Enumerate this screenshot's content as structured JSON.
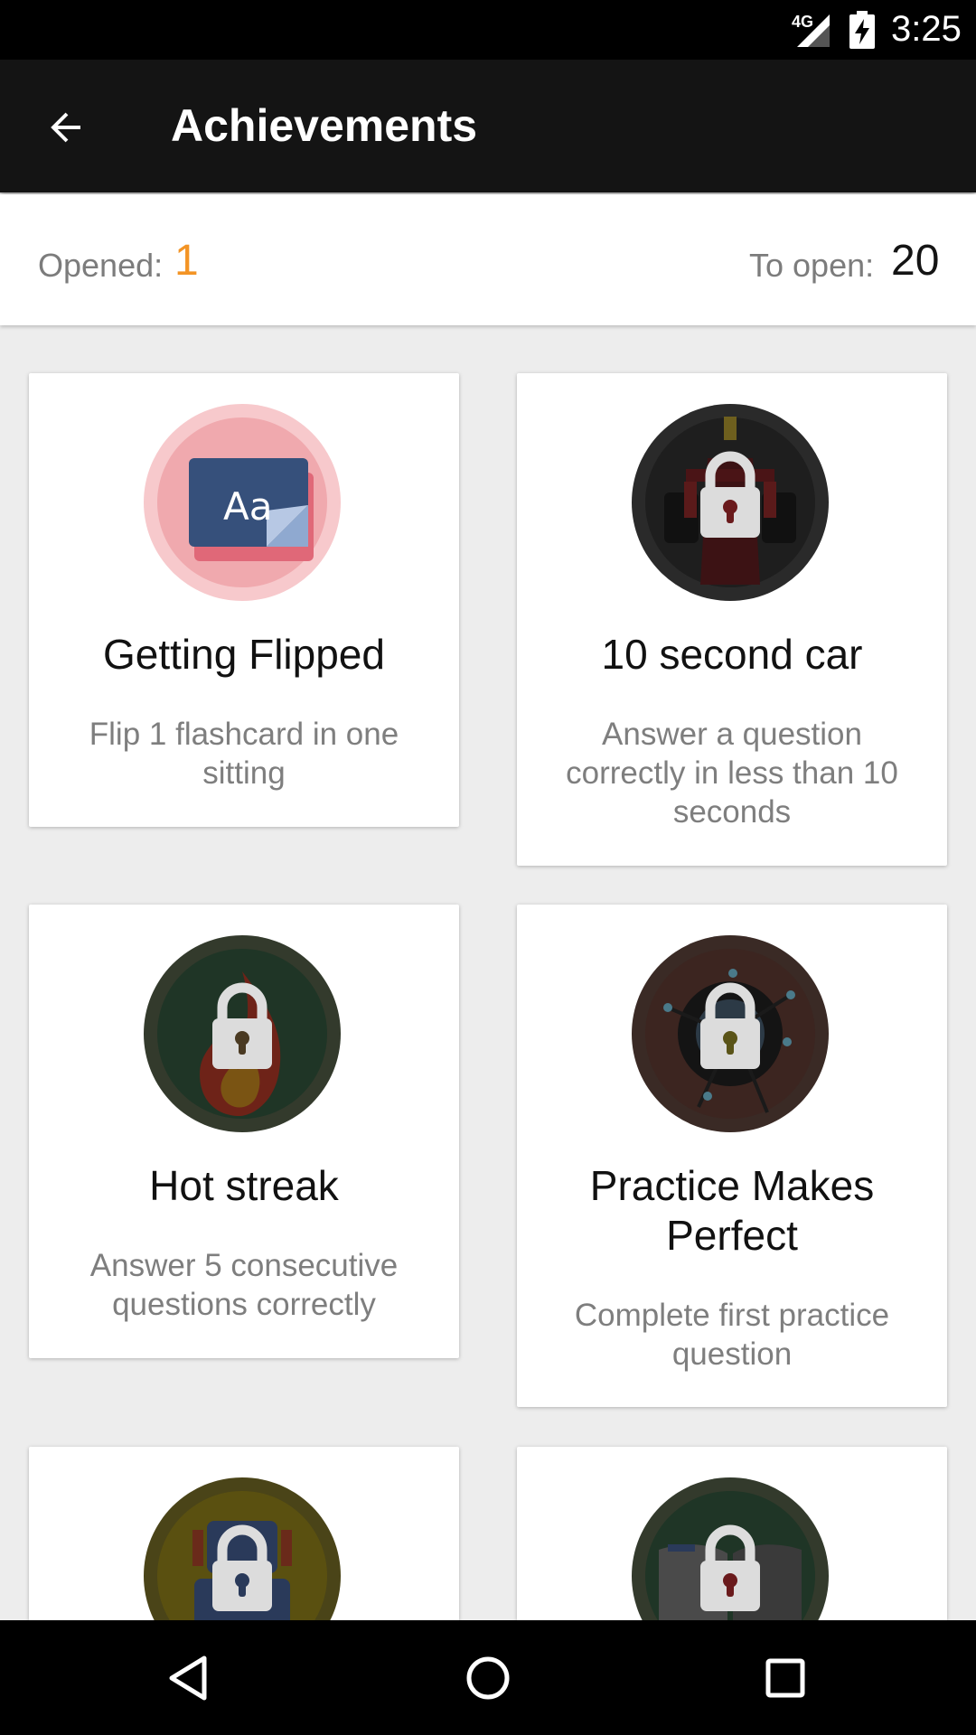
{
  "status_bar": {
    "network": "4G",
    "time": "3:25"
  },
  "app_bar": {
    "title": "Achievements",
    "back_icon": "arrow-back-icon"
  },
  "summary": {
    "opened_label": "Opened:",
    "opened_value": "1",
    "to_open_label": "To open:",
    "to_open_value": "20",
    "opened_color": "#f39425"
  },
  "achievements": [
    {
      "title": "Getting Flipped",
      "description": "Flip 1 flashcard in one sitting",
      "locked": false,
      "icon": "flashcard-icon"
    },
    {
      "title": "10 second car",
      "description": "Answer a question correctly in less than 10 seconds",
      "locked": true,
      "icon": "race-car-icon"
    },
    {
      "title": "Hot streak",
      "description": "Answer 5 consecutive questions correctly",
      "locked": true,
      "icon": "flame-icon"
    },
    {
      "title": "Practice Makes Perfect",
      "description": "Complete first practice question",
      "locked": true,
      "icon": "target-icon"
    },
    {
      "title": "",
      "description": "",
      "locked": true,
      "icon": "robot-icon"
    },
    {
      "title": "",
      "description": "",
      "locked": true,
      "icon": "book-icon"
    }
  ],
  "flashcard_text": "Aa",
  "colors": {
    "app_bar": "#141414",
    "background": "#ededed",
    "accent": "#f39425"
  }
}
